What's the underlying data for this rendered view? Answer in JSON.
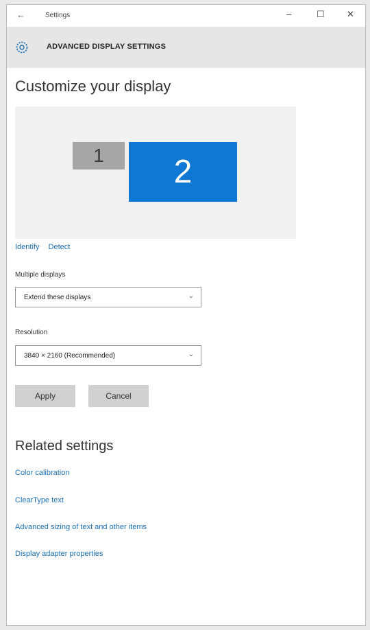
{
  "window": {
    "app_title": "Settings",
    "back_symbol": "←",
    "minimize_symbol": "–",
    "maximize_symbol": "☐",
    "close_symbol": "✕"
  },
  "header": {
    "title": "ADVANCED DISPLAY SETTINGS",
    "icon": "gear-icon"
  },
  "main": {
    "heading": "Customize your display",
    "monitors": [
      {
        "label": "1",
        "color": "#a6a6a6"
      },
      {
        "label": "2",
        "color": "#0f78d4"
      }
    ],
    "identify_label": "Identify",
    "detect_label": "Detect",
    "multiple_displays": {
      "label": "Multiple displays",
      "value": "Extend these displays"
    },
    "resolution": {
      "label": "Resolution",
      "value": "3840 × 2160 (Recommended)"
    },
    "apply_label": "Apply",
    "cancel_label": "Cancel"
  },
  "related": {
    "heading": "Related settings",
    "links": [
      "Color calibration",
      "ClearType text",
      "Advanced sizing of text and other items",
      "Display adapter properties"
    ]
  },
  "colors": {
    "accent": "#0f78d4",
    "link": "#1a70b8",
    "header_bg": "#e6e6e6"
  }
}
